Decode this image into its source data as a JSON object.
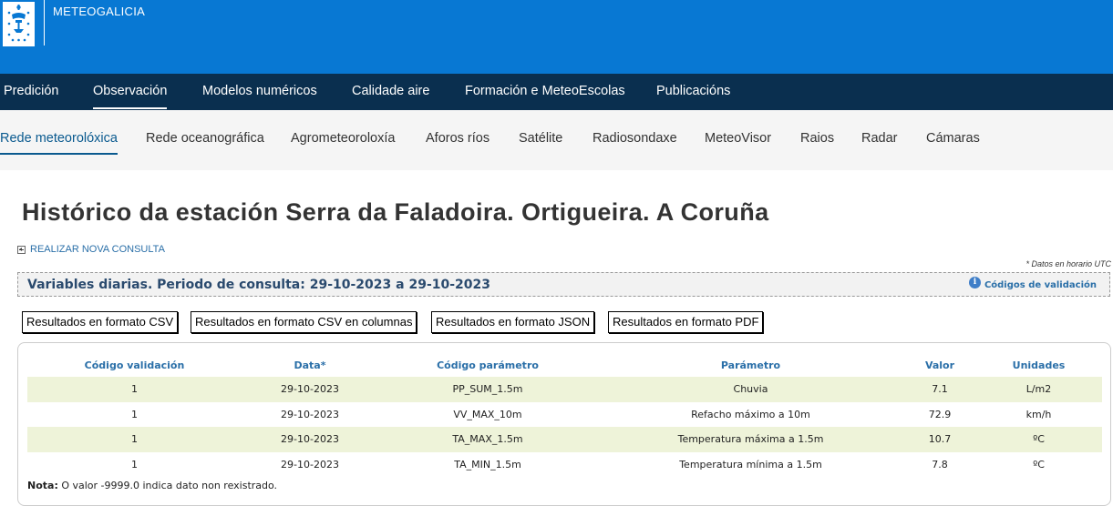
{
  "header": {
    "brand": "METEOGALICIA",
    "main_nav": [
      "Predición",
      "Observación",
      "Modelos numéricos",
      "Calidade aire",
      "Formación e MeteoEscolas",
      "Publicacións"
    ],
    "main_nav_active": "Observación",
    "sub_nav": [
      "Rede meteorolóxica",
      "Rede oceanográfica",
      "Agrometeoroloxía",
      "Aforos ríos",
      "Satélite",
      "Radiosondaxe",
      "MeteoVisor",
      "Raios",
      "Radar",
      "Cámaras"
    ],
    "sub_nav_active": "Rede meteorolóxica"
  },
  "page": {
    "title": "Histórico da estación Serra da Faladoira. Ortigueira. A Coruña",
    "back_link": "REALIZAR NOVA CONSULTA",
    "utc_note": "* Datos en horario UTC",
    "period_text": "Variables diarias. Periodo de consulta: 29-10-2023 a 29-10-2023",
    "validation_codes": "Códigos de validación",
    "buttons": {
      "csv": "Resultados en formato CSV",
      "csv_columns": "Resultados en formato CSV en columnas",
      "json": "Resultados en formato JSON",
      "pdf": "Resultados en formato PDF"
    }
  },
  "table": {
    "headers": [
      "Código validación",
      "Data*",
      "Código parámetro",
      "Parámetro",
      "Valor",
      "Unidades"
    ],
    "rows": [
      [
        "1",
        "29-10-2023",
        "PP_SUM_1.5m",
        "Chuvia",
        "7.1",
        "L/m2"
      ],
      [
        "1",
        "29-10-2023",
        "VV_MAX_10m",
        "Refacho máximo a 10m",
        "72.9",
        "km/h"
      ],
      [
        "1",
        "29-10-2023",
        "TA_MAX_1.5m",
        "Temperatura máxima a 1.5m",
        "10.7",
        "ºC"
      ],
      [
        "1",
        "29-10-2023",
        "TA_MIN_1.5m",
        "Temperatura mínima a 1.5m",
        "7.8",
        "ºC"
      ]
    ]
  },
  "note": {
    "label": "Nota:",
    "text": " O valor -9999.0 indica dato non rexistrado."
  },
  "colors": {
    "top_bar": "#0878d3",
    "main_nav": "#0a2f4f",
    "row_highlight": "#eef3d9",
    "link": "#2a6fa8"
  }
}
